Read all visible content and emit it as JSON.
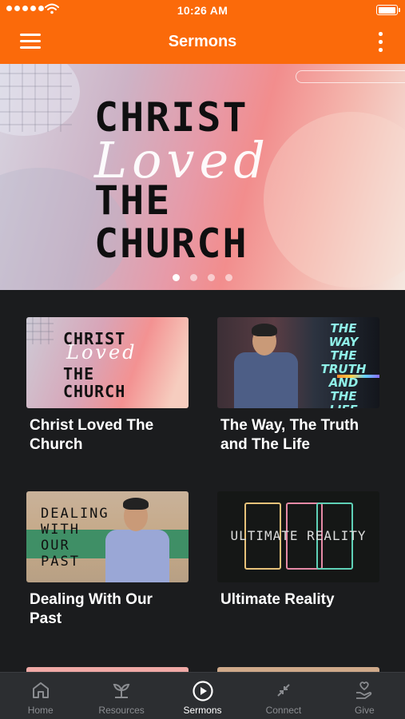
{
  "status_bar": {
    "time": "10:26 AM"
  },
  "app_bar": {
    "title": "Sermons"
  },
  "hero": {
    "line1": "CHRIST",
    "script": "Loved",
    "line2": "THE",
    "line3": "CHURCH",
    "slide_count": 4,
    "active_slide": 1
  },
  "sermons": [
    {
      "title": "Christ Loved The Church",
      "thumb_line1": "CHRIST",
      "thumb_script": "Loved",
      "thumb_line2": "THE",
      "thumb_line3": "CHURCH"
    },
    {
      "title": "The Way, The Truth and The Life",
      "thumb_text": "THE WAY THE TRUTH AND THE LIFE"
    },
    {
      "title": "Dealing With Our Past",
      "thumb_text": "DEALING WITH OUR PAST"
    },
    {
      "title": "Ultimate Reality",
      "thumb_text": "ULTIMATE REALITY"
    }
  ],
  "tabs": [
    {
      "label": "Home",
      "icon": "home-icon"
    },
    {
      "label": "Resources",
      "icon": "sprout-icon"
    },
    {
      "label": "Sermons",
      "icon": "play-circle-icon"
    },
    {
      "label": "Connect",
      "icon": "arrows-in-icon"
    },
    {
      "label": "Give",
      "icon": "heart-hand-icon"
    }
  ],
  "active_tab": "Sermons",
  "colors": {
    "accent": "#fb6a0a",
    "background": "#1b1c1e",
    "tabbar": "#2c2e31"
  }
}
